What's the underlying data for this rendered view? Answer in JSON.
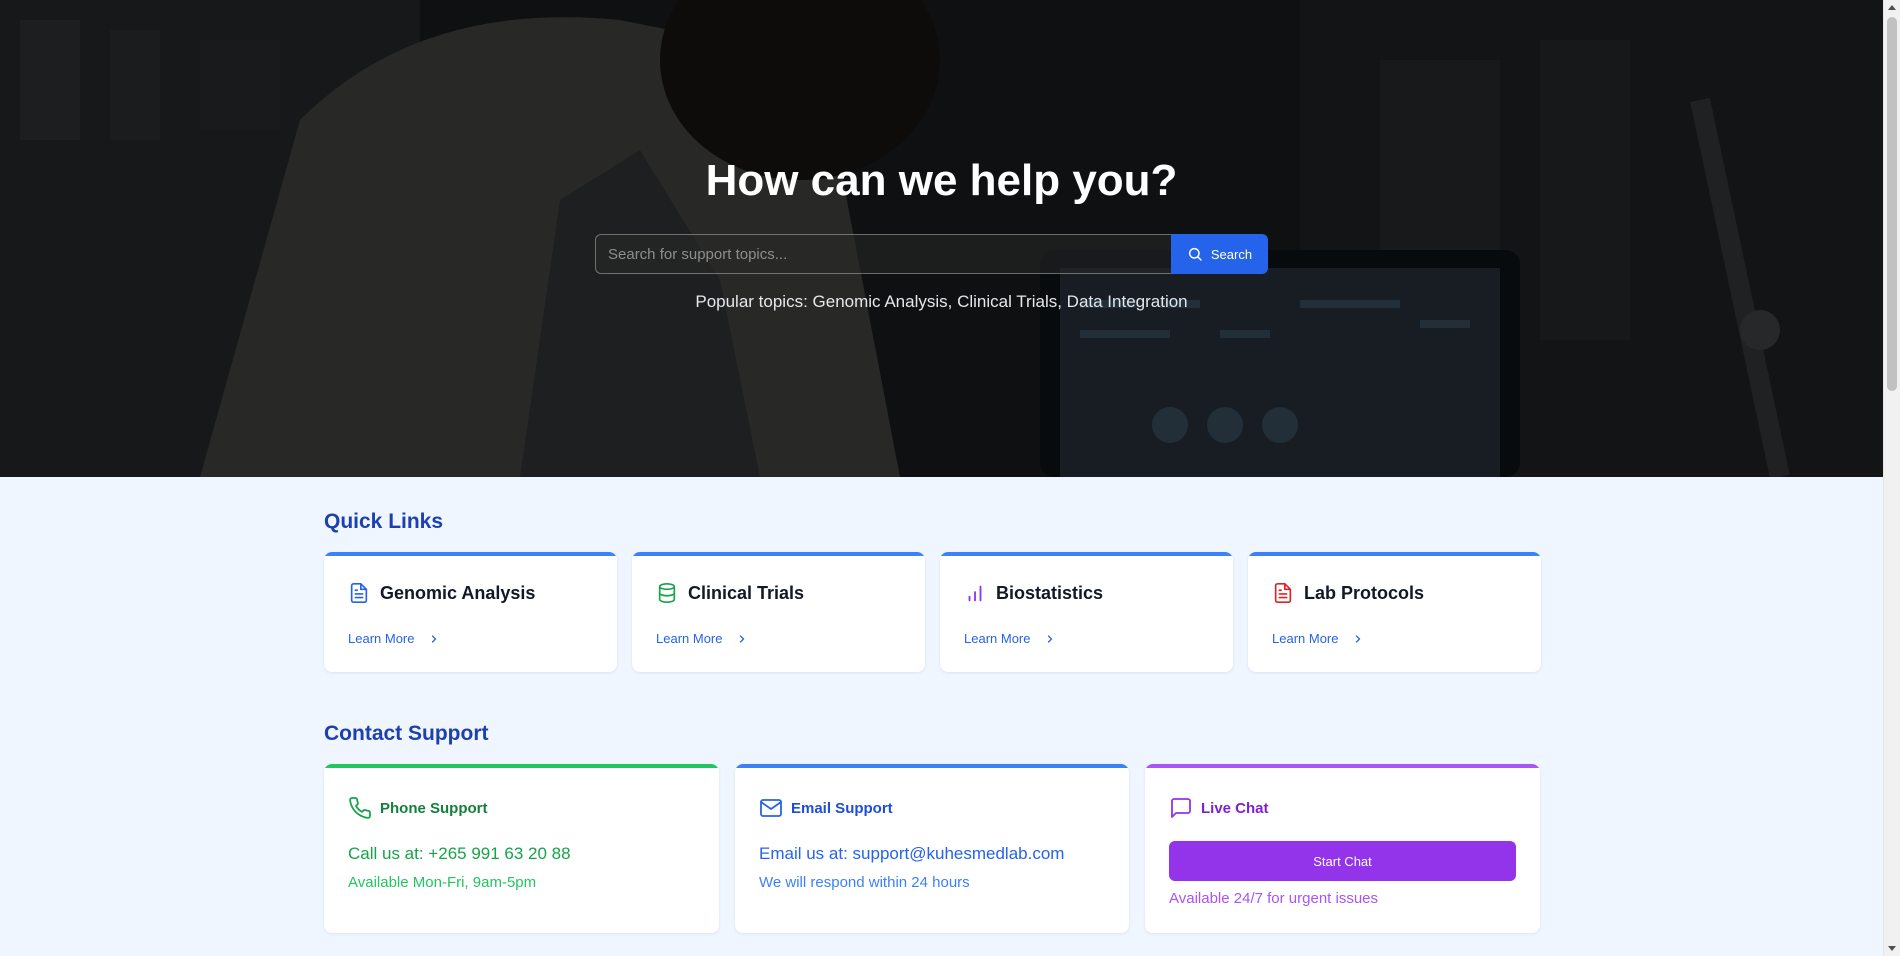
{
  "hero": {
    "title": "How can we help you?",
    "search_placeholder": "Search for support topics...",
    "search_button": "Search",
    "popular_topics": "Popular topics: Genomic Analysis, Clinical Trials, Data Integration"
  },
  "quick_links": {
    "title": "Quick Links",
    "items": [
      {
        "label": "Genomic Analysis",
        "link": "Learn More",
        "icon": "document-icon",
        "color": "#2563eb"
      },
      {
        "label": "Clinical Trials",
        "link": "Learn More",
        "icon": "database-icon",
        "color": "#16a34a"
      },
      {
        "label": "Biostatistics",
        "link": "Learn More",
        "icon": "bar-chart-icon",
        "color": "#9333ea"
      },
      {
        "label": "Lab Protocols",
        "link": "Learn More",
        "icon": "file-text-icon",
        "color": "#dc2626"
      }
    ],
    "accent": "#3b82f6"
  },
  "contact": {
    "title": "Contact Support",
    "phone": {
      "title": "Phone Support",
      "line1": "Call us at: +265 991 63 20 88",
      "line2": "Available Mon-Fri, 9am-5pm",
      "icon": "phone-icon",
      "accent": "#22c55e",
      "text_color": "#15803d"
    },
    "email": {
      "title": "Email Support",
      "line1": "Email us at: support@kuhesmedlab.com",
      "line2": "We will respond within 24 hours",
      "icon": "mail-icon",
      "accent": "#3b82f6",
      "text_color": "#1d4ed8"
    },
    "chat": {
      "title": "Live Chat",
      "button": "Start Chat",
      "note": "Available 24/7 for urgent issues",
      "icon": "message-square-icon",
      "accent": "#a855f7",
      "text_color": "#7e22ce"
    }
  }
}
